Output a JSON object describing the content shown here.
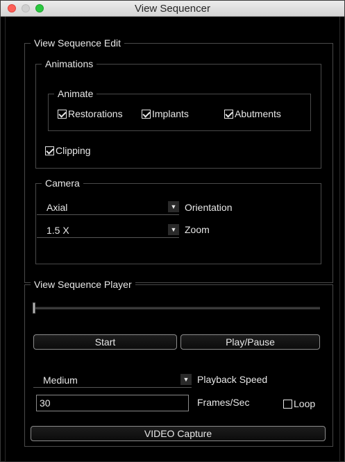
{
  "window": {
    "title": "View Sequencer"
  },
  "edit": {
    "legend": "View Sequence Edit",
    "animations": {
      "legend": "Animations",
      "animate": {
        "legend": "Animate",
        "restorations": {
          "label": "Restorations",
          "checked": true
        },
        "implants": {
          "label": "Implants",
          "checked": true
        },
        "abutments": {
          "label": "Abutments",
          "checked": true
        }
      },
      "clipping": {
        "label": "Clipping",
        "checked": true
      }
    },
    "camera": {
      "legend": "Camera",
      "orientation": {
        "value": "Axial",
        "label": "Orientation"
      },
      "zoom": {
        "value": "1.5 X",
        "label": "Zoom"
      }
    }
  },
  "player": {
    "legend": "View Sequence Player",
    "slider_position": 0.0,
    "start_label": "Start",
    "play_pause_label": "Play/Pause",
    "speed": {
      "value": "Medium",
      "label": "Playback Speed"
    },
    "fps": {
      "value": "30",
      "label": "Frames/Sec"
    },
    "loop": {
      "label": "Loop",
      "checked": false
    },
    "video_capture_label": "VIDEO Capture"
  },
  "colors": {
    "panel_background": "#000000",
    "text": "#e8e8e8",
    "close_light": "#fc5f57",
    "zoom_light": "#2ac940"
  }
}
